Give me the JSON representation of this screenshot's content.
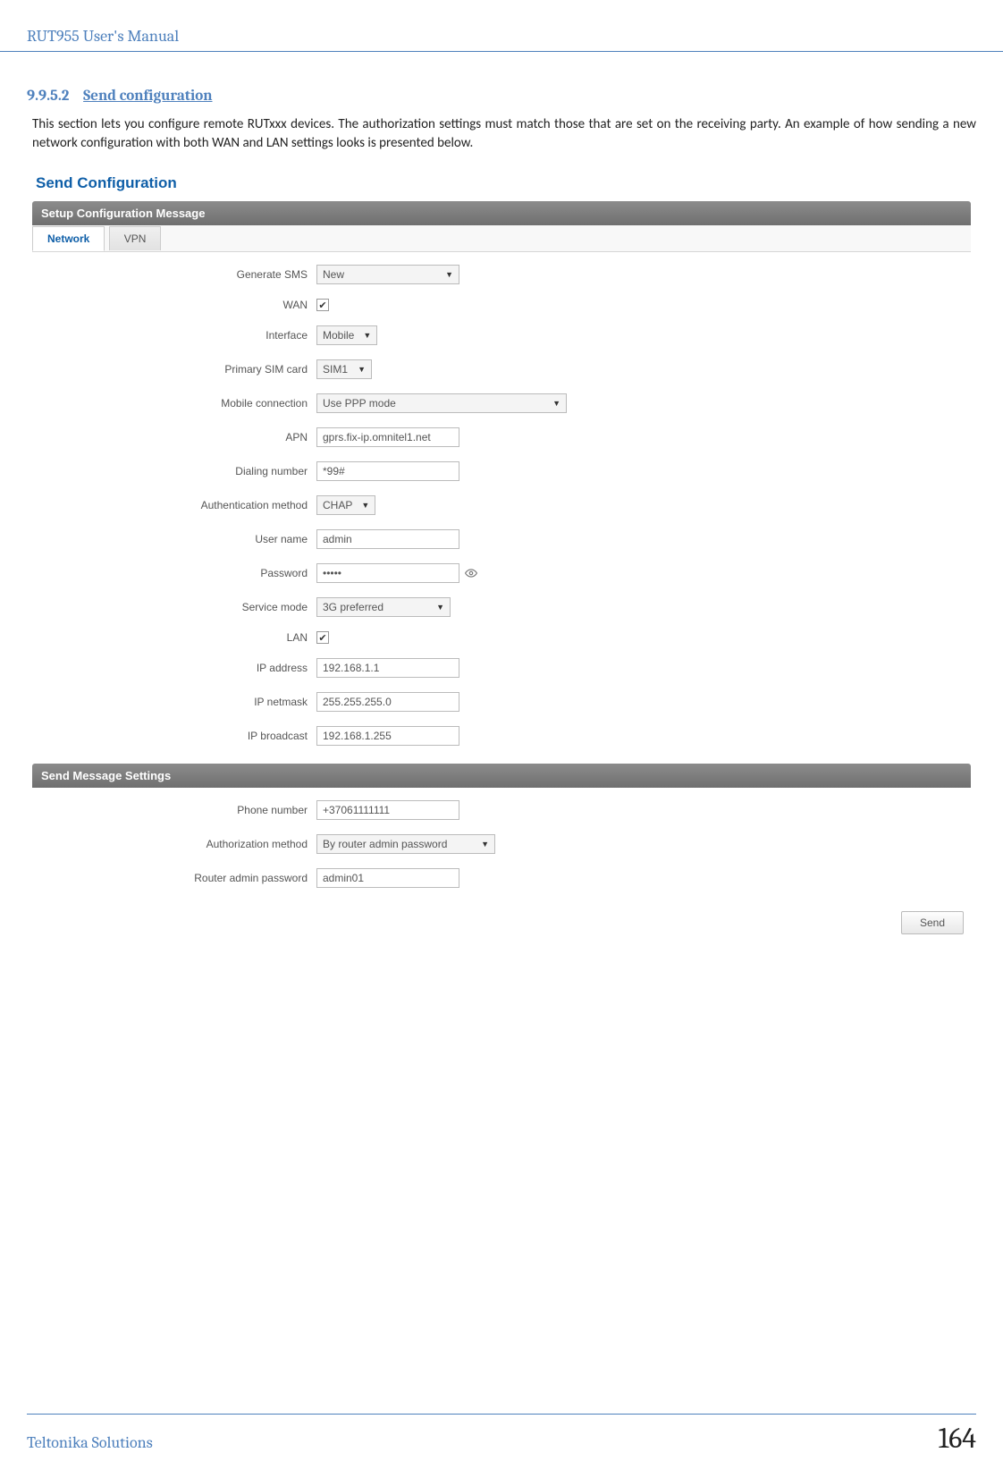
{
  "doc": {
    "header": "RUT955 User's Manual",
    "section_number": "9.9.5.2",
    "section_title": "Send configuration",
    "intro": "This section lets you configure remote RUTxxx devices. The authorization settings must match those that are set on the receiving party. An example of how sending a new network configuration with both WAN and LAN settings looks is presented below.",
    "footer_left": "Teltonika Solutions",
    "page_number": "164"
  },
  "ui": {
    "title": "Send Configuration",
    "panel1": "Setup Configuration Message",
    "tabs": {
      "network": "Network",
      "vpn": "VPN"
    },
    "labels": {
      "generate_sms": "Generate SMS",
      "wan": "WAN",
      "interface": "Interface",
      "primary_sim": "Primary SIM card",
      "mobile_conn": "Mobile connection",
      "apn": "APN",
      "dialing": "Dialing number",
      "auth_method": "Authentication method",
      "user_name": "User name",
      "password": "Password",
      "service_mode": "Service mode",
      "lan": "LAN",
      "ip_address": "IP address",
      "ip_netmask": "IP netmask",
      "ip_broadcast": "IP broadcast",
      "phone_number": "Phone number",
      "auth_method2": "Authorization method",
      "router_pwd": "Router admin password"
    },
    "values": {
      "generate_sms": "New",
      "interface": "Mobile",
      "primary_sim": "SIM1",
      "mobile_conn": "Use PPP mode",
      "apn": "gprs.fix-ip.omnitel1.net",
      "dialing": "*99#",
      "auth_method": "CHAP",
      "user_name": "admin",
      "password": "•••••",
      "service_mode": "3G preferred",
      "ip_address": "192.168.1.1",
      "ip_netmask": "255.255.255.0",
      "ip_broadcast": "192.168.1.255",
      "phone_number": "+37061111111",
      "auth_method2": "By router admin password",
      "router_pwd": "admin01"
    },
    "panel2": "Send Message Settings",
    "send_btn": "Send"
  }
}
